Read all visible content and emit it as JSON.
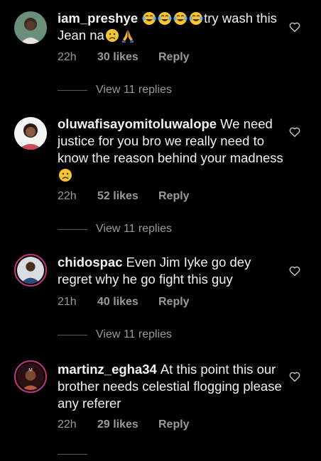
{
  "comments": [
    {
      "username": "iam_preshye",
      "text_before": "",
      "text_after": "try wash this Jean na",
      "time": "22h",
      "likes": "30 likes",
      "reply": "Reply",
      "view_replies": "View 11 replies"
    },
    {
      "username": "oluwafisayomitoluwalope",
      "text": "We need justice for you bro we really need to know the reason behind your madness",
      "time": "22h",
      "likes": "52 likes",
      "reply": "Reply",
      "view_replies": "View 11 replies"
    },
    {
      "username": "chidospac",
      "text": "Even Jim Iyke go dey regret why he go fight this guy",
      "time": "21h",
      "likes": "40 likes",
      "reply": "Reply",
      "view_replies": "View 11 replies"
    },
    {
      "username": "martinz_egha34",
      "text": "At this point this our brother needs celestial flogging please any referer",
      "time": "22h",
      "likes": "29 likes",
      "reply": "Reply"
    }
  ],
  "icons": {
    "like": "heart-outline-icon",
    "laugh": "tears-of-joy-emoji",
    "sad": "crying-face-emoji",
    "pray": "folded-hands-emoji"
  },
  "colors": {
    "background": "#000000",
    "text": "#f2f2f2",
    "secondary": "#9a9a9a",
    "story_ring": "#c13584"
  }
}
